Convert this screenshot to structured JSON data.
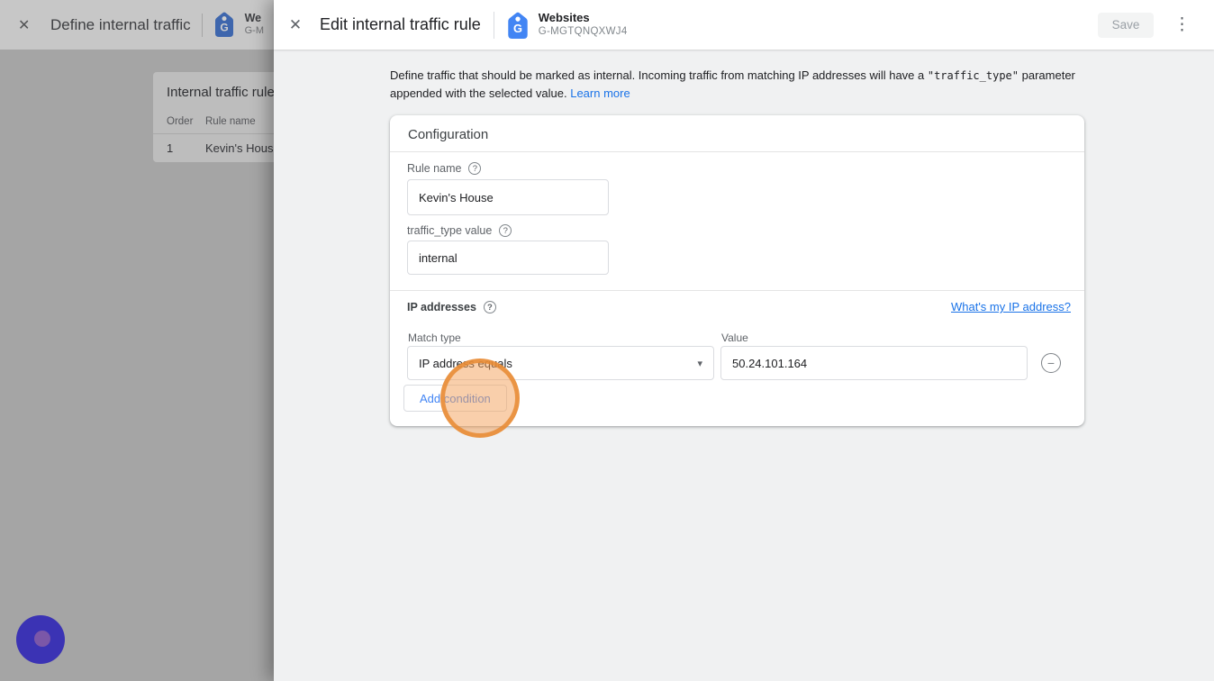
{
  "icons": {
    "close": "✕",
    "help": "?",
    "kebab": "⋮",
    "caret": "▾",
    "minus": "−",
    "logo_letter": "G"
  },
  "colors": {
    "accent_blue": "#4285f4",
    "link_blue": "#1a73e8",
    "highlight_ring": "#e78a33",
    "cursor_outer": "#3b33b4",
    "cursor_inner": "#7b57a8"
  },
  "background_panel": {
    "title": "Define internal traffic",
    "property": {
      "name": "We",
      "id": "G-M"
    },
    "card": {
      "title": "Internal traffic rule",
      "columns": {
        "order": "Order",
        "rule_name": "Rule name"
      },
      "rows": [
        {
          "order": "1",
          "rule_name": "Kevin's Hous"
        }
      ]
    }
  },
  "dialog": {
    "title": "Edit internal traffic rule",
    "property": {
      "name": "Websites",
      "id": "G-MGTQNQXWJ4"
    },
    "toolbar": {
      "save_label": "Save"
    },
    "description": {
      "text_before": "Define traffic that should be marked as internal. Incoming traffic from matching IP addresses will have a ",
      "code": "\"traffic_type\"",
      "text_after": " parameter appended with the selected value.",
      "link": "Learn more"
    },
    "card": {
      "title": "Configuration",
      "rule_name": {
        "label": "Rule name",
        "value": "Kevin's House"
      },
      "traffic_type": {
        "label": "traffic_type value",
        "value": "internal"
      },
      "ip": {
        "label": "IP addresses",
        "help_link": "What's my IP address?",
        "match_type": {
          "label": "Match type",
          "value": "IP address equals"
        },
        "value_field": {
          "label": "Value",
          "value": "50.24.101.164"
        },
        "add_condition_label": "Add condition"
      }
    }
  }
}
